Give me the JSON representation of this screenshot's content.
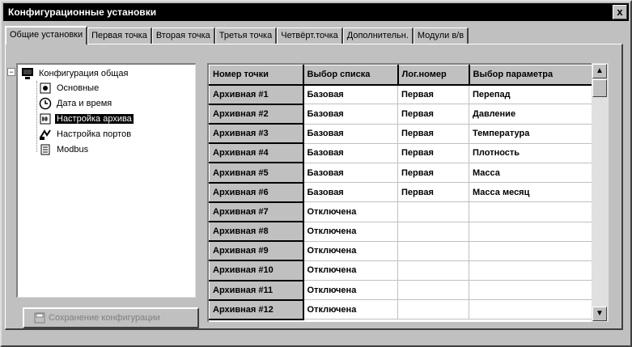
{
  "window": {
    "title": "Конфигурационные установки",
    "close_label": "x"
  },
  "tabs": [
    {
      "label": "Общие установки"
    },
    {
      "label": "Первая точка"
    },
    {
      "label": "Вторая точка"
    },
    {
      "label": "Третья точка"
    },
    {
      "label": "Четвёрт.точка"
    },
    {
      "label": "Дополнительн."
    },
    {
      "label": "Модули в/в"
    }
  ],
  "tree": {
    "root": {
      "label": "Конфигурация общая",
      "icon": "computer-icon"
    },
    "children": [
      {
        "label": "Основные",
        "icon": "settings-icon"
      },
      {
        "label": "Дата и время",
        "icon": "clock-icon"
      },
      {
        "label": "Настройка архива",
        "icon": "archive-icon"
      },
      {
        "label": "Настройка портов",
        "icon": "ports-icon"
      },
      {
        "label": "Modbus",
        "icon": "modbus-icon"
      }
    ]
  },
  "save_button": {
    "label": "Сохранение конфигурации",
    "icon": "save-icon"
  },
  "grid": {
    "columns": [
      "Номер точки",
      "Выбор списка",
      "Лог.номер",
      "Выбор параметра"
    ],
    "rows": [
      [
        "Архивная #1",
        "Базовая",
        "Первая",
        "Перепад"
      ],
      [
        "Архивная #2",
        "Базовая",
        "Первая",
        "Давление"
      ],
      [
        "Архивная #3",
        "Базовая",
        "Первая",
        "Температура"
      ],
      [
        "Архивная #4",
        "Базовая",
        "Первая",
        "Плотность"
      ],
      [
        "Архивная #5",
        "Базовая",
        "Первая",
        "Масса"
      ],
      [
        "Архивная #6",
        "Базовая",
        "Первая",
        "Масса месяц"
      ],
      [
        "Архивная #7",
        "Отключена",
        "",
        ""
      ],
      [
        "Архивная #8",
        "Отключена",
        "",
        ""
      ],
      [
        "Архивная #9",
        "Отключена",
        "",
        ""
      ],
      [
        "Архивная #10",
        "Отключена",
        "",
        ""
      ],
      [
        "Архивная #11",
        "Отключена",
        "",
        ""
      ],
      [
        "Архивная #12",
        "Отключена",
        "",
        ""
      ]
    ]
  },
  "scrollbar": {
    "up_icon": "arrow-up-icon",
    "down_icon": "arrow-down-icon"
  }
}
